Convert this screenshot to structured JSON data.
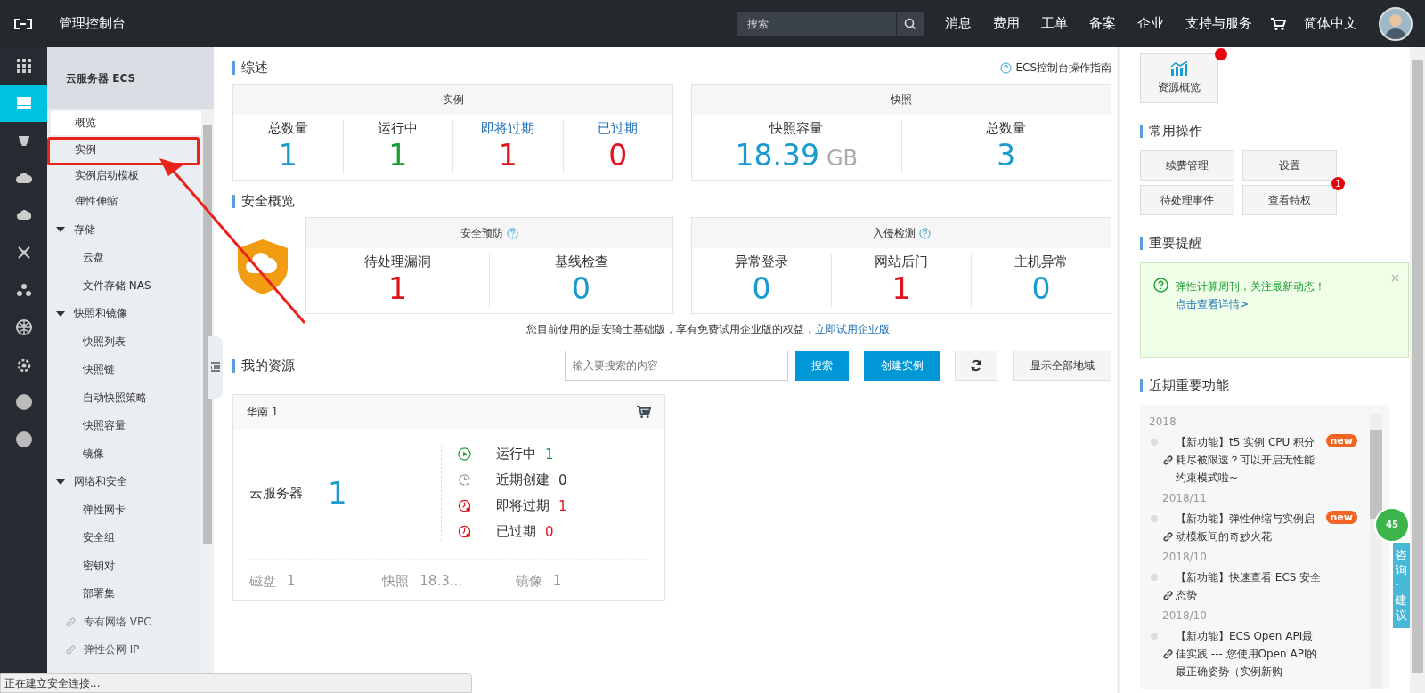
{
  "topbar": {
    "title": "管理控制台",
    "search": {
      "placeholder": "搜索"
    },
    "nav": [
      "消息",
      "费用",
      "工单",
      "备案",
      "企业",
      "支持与服务"
    ],
    "language": "简体中文"
  },
  "rail": [
    {
      "kind": "apps",
      "selected": false
    },
    {
      "kind": "server",
      "selected": true
    },
    {
      "kind": "monkey",
      "selected": false
    },
    {
      "kind": "cloud",
      "selected": false
    },
    {
      "kind": "cloud-gear",
      "selected": false
    },
    {
      "kind": "network",
      "selected": false
    },
    {
      "kind": "cluster",
      "selected": false
    },
    {
      "kind": "globe",
      "selected": false
    },
    {
      "kind": "gear-cloud",
      "selected": false
    },
    {
      "kind": "dot",
      "selected": false
    },
    {
      "kind": "dot",
      "selected": false
    }
  ],
  "sidebar": {
    "title": "云服务器 ECS",
    "items": [
      {
        "kind": "page",
        "label": "概览",
        "selected": true
      },
      {
        "kind": "page",
        "label": "实例",
        "selected": false
      },
      {
        "kind": "page",
        "label": "实例启动模板",
        "selected": false
      },
      {
        "kind": "page",
        "label": "弹性伸缩",
        "selected": false
      },
      {
        "kind": "group",
        "label": "存储",
        "expanded": true,
        "children": [
          {
            "label": "云盘",
            "selected": false
          },
          {
            "label": "文件存储 NAS",
            "selected": false
          }
        ]
      },
      {
        "kind": "group",
        "label": "快照和镜像",
        "expanded": true,
        "children": [
          {
            "label": "快照列表",
            "selected": false
          },
          {
            "label": "快照链",
            "selected": false
          },
          {
            "label": "自动快照策略",
            "selected": false
          },
          {
            "label": "快照容量",
            "selected": false
          },
          {
            "label": "镜像",
            "selected": false
          }
        ]
      },
      {
        "kind": "group",
        "label": "网络和安全",
        "expanded": true,
        "children": [
          {
            "label": "弹性网卡",
            "selected": false
          },
          {
            "label": "安全组",
            "selected": false
          },
          {
            "label": "密钥对",
            "selected": false
          },
          {
            "label": "部署集",
            "selected": false
          }
        ]
      },
      {
        "kind": "link",
        "label": "专有网络 VPC",
        "selected": false
      },
      {
        "kind": "link",
        "label": "弹性公网 IP",
        "selected": false
      }
    ]
  },
  "overview": {
    "title": "综述",
    "guide_link": "ECS控制台操作指南",
    "instances": {
      "title": "实例",
      "stats": [
        {
          "label": "总数量",
          "link": false,
          "value": "1",
          "color": "#1a9bd0"
        },
        {
          "label": "运行中",
          "link": false,
          "value": "1",
          "color": "#1f9d35"
        },
        {
          "label": "即将过期",
          "link": true,
          "value": "1",
          "color": "#e0141e"
        },
        {
          "label": "已过期",
          "link": true,
          "value": "0",
          "color": "#e0141e"
        }
      ]
    },
    "snapshots": {
      "title": "快照",
      "stats": [
        {
          "label": "快照容量",
          "value": "18.39",
          "unit": "GB",
          "color": "#1a9bd0"
        },
        {
          "label": "总数量",
          "value": "3",
          "color": "#1a9bd0"
        }
      ]
    }
  },
  "security": {
    "title": "安全概览",
    "panels": [
      {
        "title": "安全预防",
        "stats": [
          {
            "label": "待处理漏洞",
            "value": "1",
            "color": "#e0141e"
          },
          {
            "label": "基线检查",
            "value": "0",
            "color": "#1a9bd0"
          }
        ]
      },
      {
        "title": "入侵检测",
        "stats": [
          {
            "label": "异常登录",
            "value": "0",
            "color": "#1a9bd0"
          },
          {
            "label": "网站后门",
            "value": "1",
            "color": "#e0141e"
          },
          {
            "label": "主机异常",
            "value": "0",
            "color": "#1a9bd0"
          }
        ]
      }
    ],
    "note": "您目前使用的是安骑士基础版，享有免费试用企业版的权益，",
    "note_link": "立即试用企业版"
  },
  "resources": {
    "title": "我的资源",
    "search": {
      "placeholder": "输入要搜索的内容"
    },
    "search_button": "搜索",
    "create_button": "创建实例",
    "all_regions_button": "显示全部地域",
    "region": {
      "name": "华南 1",
      "product": "云服务器",
      "count": "1",
      "statuses": [
        {
          "kind": "running",
          "label": "运行中",
          "value": "1",
          "color": "#1f9d35"
        },
        {
          "kind": "recent",
          "label": "近期创建",
          "value": "0",
          "color": "#333333"
        },
        {
          "kind": "expiring",
          "label": "即将过期",
          "value": "1",
          "color": "#e0141e"
        },
        {
          "kind": "expired",
          "label": "已过期",
          "value": "0",
          "color": "#e0141e"
        }
      ],
      "footer": [
        {
          "label": "磁盘",
          "value": "1"
        },
        {
          "label": "快照",
          "value": "18.3..."
        },
        {
          "label": "镜像",
          "value": "1"
        }
      ]
    }
  },
  "right": {
    "overview_button": {
      "label": "资源概览",
      "dot": true
    },
    "ops": {
      "title": "常用操作",
      "buttons": [
        {
          "label": "续费管理"
        },
        {
          "label": "设置"
        },
        {
          "label": "待处理事件"
        },
        {
          "label": "查看特权",
          "badge": "1"
        }
      ]
    },
    "reminder": {
      "title": "重要提醒",
      "text": "弹性计算周刊，关注最新动态！",
      "link": "点击查看详情>"
    },
    "features": {
      "title": "近期重要功能",
      "groups": [
        {
          "date": "2018",
          "items": [
            {
              "text": "【新功能】t5 实例 CPU 积分耗尽被限速？可以开启无性能约束模式啦~",
              "badge": "new"
            }
          ]
        },
        {
          "date": "2018/11",
          "items": [
            {
              "text": "【新功能】弹性伸缩与实例启动模板间的奇妙火花",
              "badge": "new"
            }
          ]
        },
        {
          "date": "2018/10",
          "items": [
            {
              "text": "【新功能】快速查看 ECS 安全态势"
            }
          ]
        },
        {
          "date": "2018/10",
          "items": [
            {
              "text": "【新功能】ECS Open API最佳实践 --- 您使用Open API的最正确姿势（实例新购"
            }
          ]
        }
      ]
    }
  },
  "float_widget": {
    "count": "45",
    "label": "咨询·建议"
  },
  "status_bar": "正在建立安全连接...",
  "annotation": {
    "kind": "box-arrow"
  }
}
